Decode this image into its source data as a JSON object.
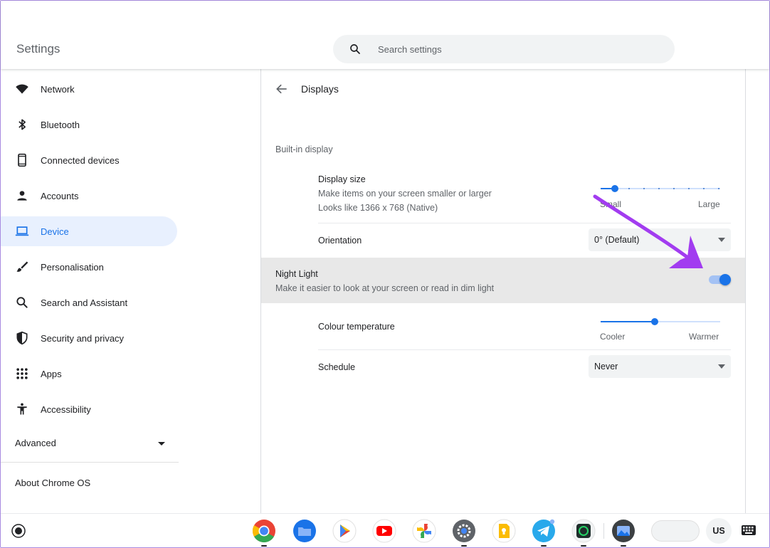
{
  "header": {
    "title": "Settings",
    "search_placeholder": "Search settings"
  },
  "sidebar": {
    "items": [
      {
        "label": "Network",
        "icon": "wifi-icon"
      },
      {
        "label": "Bluetooth",
        "icon": "bluetooth-icon"
      },
      {
        "label": "Connected devices",
        "icon": "phone-icon"
      },
      {
        "label": "Accounts",
        "icon": "person-icon"
      },
      {
        "label": "Device",
        "icon": "laptop-icon",
        "active": true
      },
      {
        "label": "Personalisation",
        "icon": "brush-icon"
      },
      {
        "label": "Search and Assistant",
        "icon": "search-icon"
      },
      {
        "label": "Security and privacy",
        "icon": "shield-icon"
      },
      {
        "label": "Apps",
        "icon": "grid-icon"
      },
      {
        "label": "Accessibility",
        "icon": "accessibility-icon"
      }
    ],
    "advanced_label": "Advanced",
    "about_label": "About Chrome OS"
  },
  "main": {
    "page_title": "Displays",
    "section_title": "Built-in display",
    "display_size": {
      "title": "Display size",
      "subtitle": "Make items on your screen smaller or larger",
      "native_text": "Looks like 1366 x 768 (Native)",
      "min_label": "Small",
      "max_label": "Large",
      "value_fraction": 0.12
    },
    "orientation": {
      "title": "Orientation",
      "value": "0° (Default)"
    },
    "night_light": {
      "title": "Night Light",
      "subtitle": "Make it easier to look at your screen or read in dim light",
      "enabled": true
    },
    "colour_temperature": {
      "title": "Colour temperature",
      "min_label": "Cooler",
      "max_label": "Warmer",
      "value_fraction": 0.45
    },
    "schedule": {
      "title": "Schedule",
      "value": "Never"
    }
  },
  "shelf": {
    "apps": [
      "chrome-icon",
      "files-icon",
      "play-store-icon",
      "youtube-icon",
      "photos-icon",
      "settings-icon",
      "keep-icon",
      "telegram-icon",
      "whatsapp-icon",
      "gallery-icon"
    ],
    "ime_label": "US"
  },
  "colors": {
    "accent": "#1a73e8",
    "annotation_arrow": "#a23cf0"
  }
}
